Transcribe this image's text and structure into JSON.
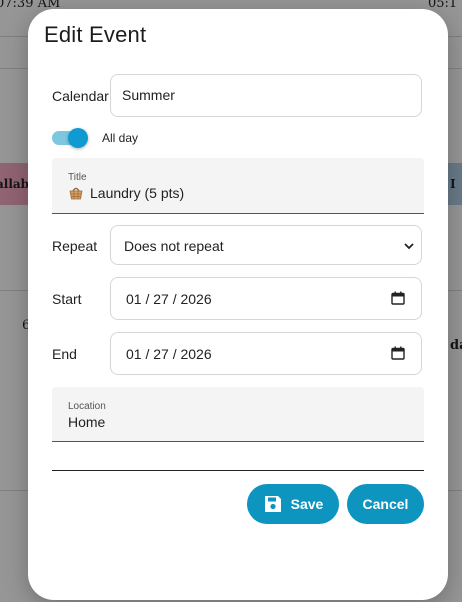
{
  "background": {
    "time_left": "07:39 AM",
    "time_right": "05:1",
    "chip_left": "allab",
    "chip_right": "I",
    "num_left": "6",
    "text_right": "da"
  },
  "dialog": {
    "title": "Edit Event",
    "calendar": {
      "label": "Calendar",
      "value": "Summer"
    },
    "all_day": {
      "label": "All day",
      "on": true
    },
    "title_field": {
      "label": "Title",
      "icon": "basket-icon",
      "value": "Laundry (5 pts)"
    },
    "repeat": {
      "label": "Repeat",
      "value": "Does not repeat"
    },
    "start": {
      "label": "Start",
      "value": "01 / 27 / 2026",
      "icon": "calendar-icon"
    },
    "end": {
      "label": "End",
      "value": "01 / 27 / 2026",
      "icon": "calendar-icon"
    },
    "location": {
      "label": "Location",
      "value": "Home"
    },
    "save_label": "Save",
    "cancel_label": "Cancel"
  },
  "colors": {
    "accent": "#0d95bf",
    "toggle_track": "#7ec7df",
    "toggle_thumb": "#0f9bd1"
  }
}
